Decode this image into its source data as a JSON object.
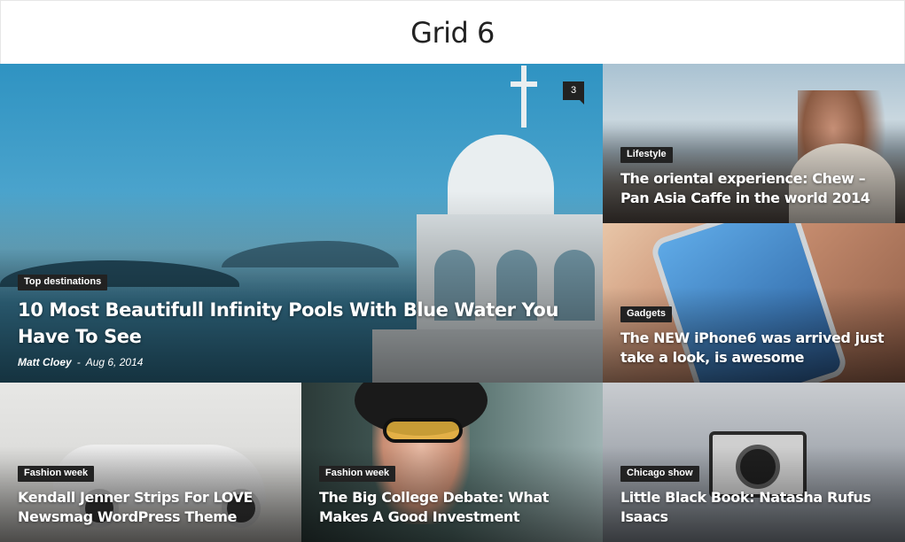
{
  "header": {
    "title": "Grid 6"
  },
  "tiles": [
    {
      "category": "Top destinations",
      "title": "10 Most Beautifull Infinity Pools With Blue Water You Have To See",
      "author": "Matt Cloey",
      "separator": "-",
      "date": "Aug 6, 2014",
      "comments": "3"
    },
    {
      "category": "Lifestyle",
      "title": "The oriental experience: Chew – Pan Asia Caffe in the world 2014"
    },
    {
      "category": "Gadgets",
      "title": "The NEW iPhone6 was arrived just take a look, is awesome"
    },
    {
      "category": "Fashion week",
      "title": "Kendall Jenner Strips For LOVE Newsmag WordPress Theme"
    },
    {
      "category": "Fashion week",
      "title": "The Big College Debate: What Makes A Good Investment"
    },
    {
      "category": "Chicago show",
      "title": "Little Black Book: Natasha Rufus Isaacs"
    }
  ],
  "colors": {
    "category_badge_bg": "#222222",
    "title_text": "#ffffff"
  }
}
